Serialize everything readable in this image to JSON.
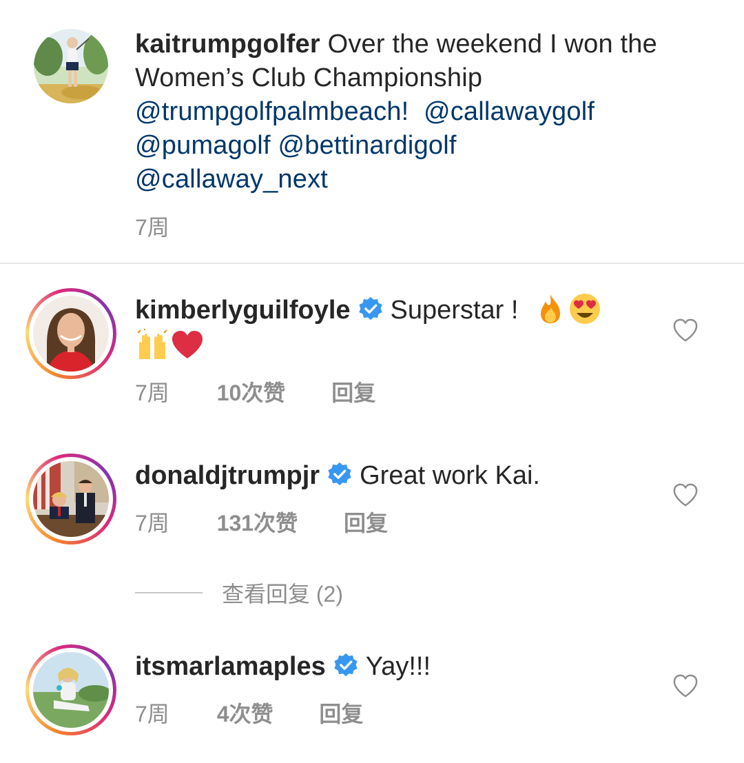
{
  "post": {
    "username": "kaitrumpgolfer",
    "caption_text": " Over the weekend I won the Women’s Club Championship ",
    "mentions": [
      "@trumpgolfpalmbeach!",
      "@callawaygolf",
      "@pumagolf",
      "@bettinardigolf",
      "@callaway_next"
    ],
    "time": "7周"
  },
  "comments": [
    {
      "username": "kimberlyguilfoyle",
      "text": "Superstar !",
      "emojis": [
        "fire-emoji",
        "heart-eyes-emoji",
        "raised-hands-emoji",
        "red-heart-emoji"
      ],
      "time": "7周",
      "likes": "10次赞",
      "reply": "回复"
    },
    {
      "username": "donaldjtrumpjr",
      "text": "Great work Kai.",
      "time": "7周",
      "likes": "131次赞",
      "reply": "回复",
      "view_replies": "查看回复 (2)"
    },
    {
      "username": "itsmarlamaples",
      "text": "Yay!!!",
      "time": "7周",
      "likes": "4次赞",
      "reply": "回复"
    }
  ],
  "colors": {
    "text": "#262626",
    "mention": "#00376b",
    "meta": "#8e8e8e",
    "verified": "#3897f0"
  }
}
